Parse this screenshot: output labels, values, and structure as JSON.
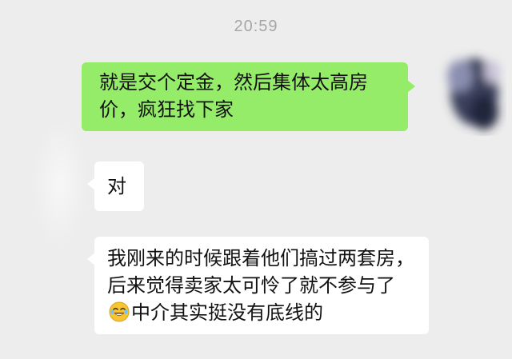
{
  "timestamp": "20:59",
  "messages": [
    {
      "direction": "sent",
      "text": "就是交个定金，然后集体太高房价，疯狂找下家"
    },
    {
      "direction": "received",
      "text": "对"
    },
    {
      "direction": "received",
      "text_before": "我刚来的时候跟着他们搞过两套房，后来觉得卖家太可怜了就不参与了",
      "emoji": "laughing-crying-emoji",
      "text_after": "中介其实挺没有底线的"
    }
  ],
  "avatar": {
    "icon": "blurred-avatar-icon"
  },
  "colors": {
    "background": "#ededed",
    "sent_bubble": "#95ec69",
    "received_bubble": "#ffffff",
    "timestamp": "#a6a6a6"
  }
}
